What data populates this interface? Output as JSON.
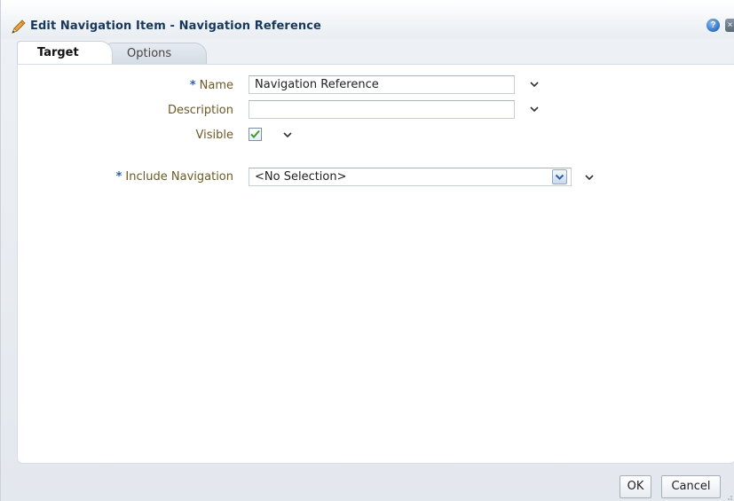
{
  "dialog": {
    "title": "Edit Navigation Item - Navigation Reference",
    "help_icon": "help-icon",
    "close_icon": "close-icon",
    "close_glyph": "×"
  },
  "tabs": [
    {
      "label": "Target",
      "selected": true
    },
    {
      "label": "Options",
      "selected": false
    }
  ],
  "form": {
    "required_marker": "*",
    "name": {
      "label": "Name",
      "required": true,
      "value": ""
    },
    "name_value": "Navigation Reference",
    "description": {
      "label": "Description",
      "required": false,
      "value": ""
    },
    "visible": {
      "label": "Visible",
      "checked": true
    },
    "include_navigation": {
      "label": "Include Navigation",
      "required": true,
      "value": "<No Selection>"
    }
  },
  "buttons": {
    "ok": "OK",
    "cancel": "Cancel"
  },
  "colors": {
    "title": "#17385c",
    "label": "#6b5a24",
    "required": "#2f62a8",
    "check": "#3a9a3a"
  }
}
